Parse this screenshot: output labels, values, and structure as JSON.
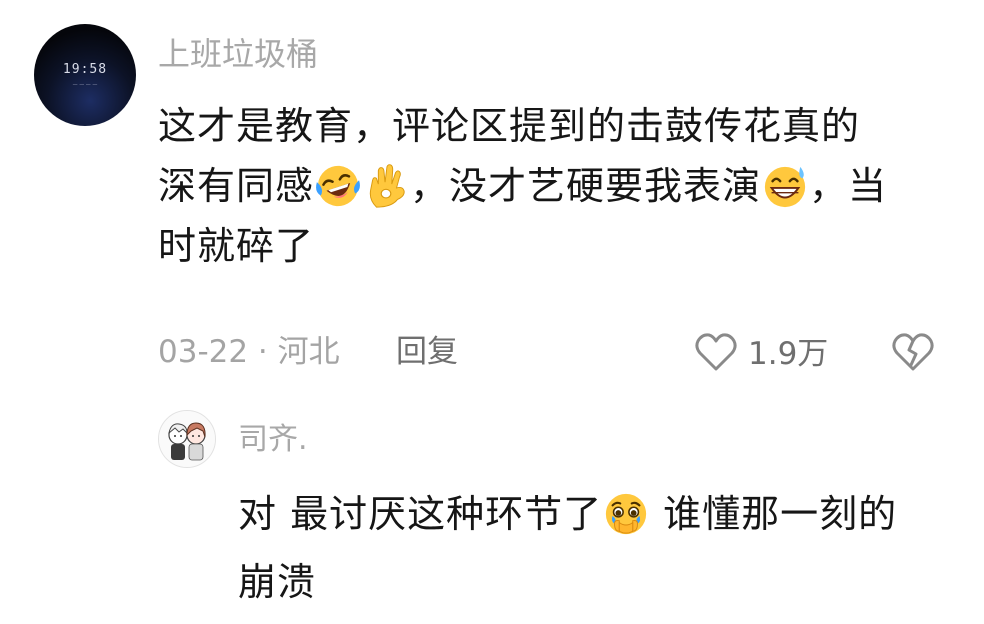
{
  "main_comment": {
    "username": "上班垃圾桶",
    "avatar_text": "19:58",
    "text_line1": "这才是教育，评论区提到的击鼓传花真的",
    "text_line2a": "深有同感",
    "text_line2b": "，没才艺硬要我表演",
    "text_line2c": "，当",
    "text_line3": "时就碎了",
    "date_location": "03-22 · 河北",
    "reply_label": "回复",
    "like_count": "1.9万",
    "emojis": [
      "laughing-crying-emoji",
      "ok-hand-emoji",
      "grinning-sweat-emoji"
    ]
  },
  "reply_comment": {
    "username": "司齐.",
    "text_line1a": "对 最讨厌这种环节了",
    "text_line1b": " 谁懂那一刻的",
    "text_line2": "崩溃",
    "emojis": [
      "holding-back-tears-emoji"
    ]
  },
  "colors": {
    "username": "#a8a8a8",
    "body_text": "#161616",
    "meta_text": "#a4a4a4",
    "emoji_yellow": "#ffc83d"
  }
}
